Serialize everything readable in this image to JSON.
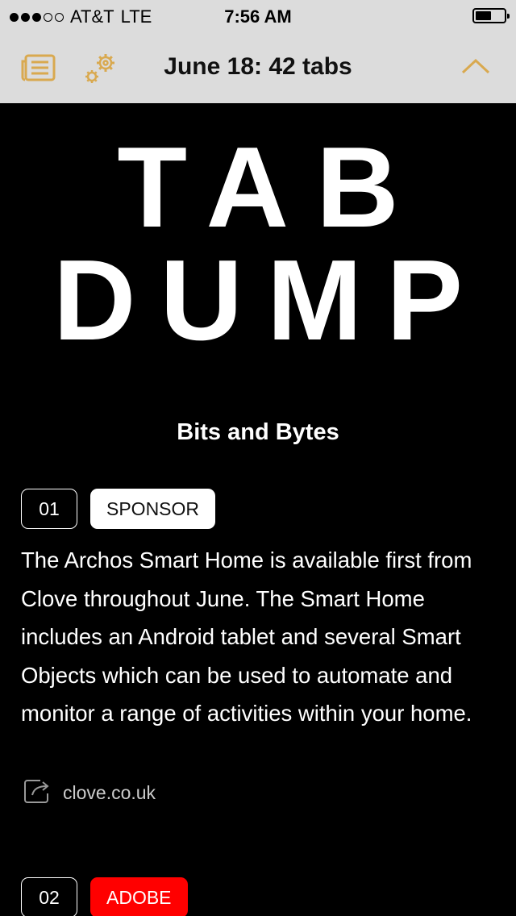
{
  "status_bar": {
    "carrier": "AT&T",
    "network": "LTE",
    "time": "7:56 AM",
    "signal_bars": 3,
    "signal_max": 5,
    "battery_level": 0.55
  },
  "toolbar": {
    "title": "June 18: 42 tabs",
    "accent_color": "#d9a94f",
    "icons": [
      "articles-icon",
      "gear-icon",
      "chevron-up-icon"
    ]
  },
  "logo": {
    "line1": "TAB",
    "line2": "DUMP"
  },
  "section": {
    "title": "Bits and Bytes"
  },
  "items": [
    {
      "number": "01",
      "tag": "SPONSOR",
      "tag_color": "#ffffff",
      "text": "The Archos Smart Home is available first from Clove throughout June. The Smart Home includes an Android tablet and several Smart Objects which can be used to automate and monitor a range of activities within your home.",
      "link": "clove.co.uk"
    },
    {
      "number": "02",
      "tag": "ADOBE",
      "tag_color": "#ff0000"
    }
  ]
}
